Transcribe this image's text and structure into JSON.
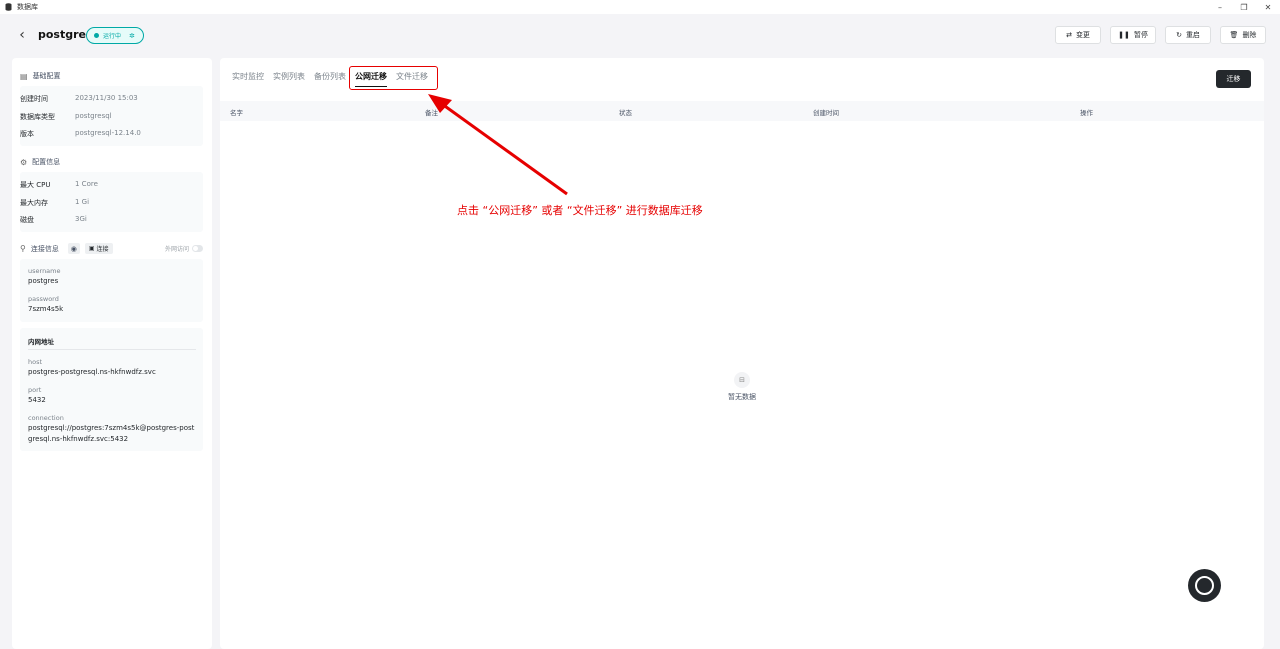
{
  "window": {
    "title": "数据库",
    "controls": [
      "–",
      "❐",
      "✕"
    ]
  },
  "header": {
    "back_icon": "chevron-left-icon",
    "db_name": "postgres",
    "status": "运行中",
    "status_color": "#00a9a6",
    "actions": [
      {
        "label": "变更",
        "icon": "⇄"
      },
      {
        "label": "暂停",
        "icon": "❚❚"
      },
      {
        "label": "重启",
        "icon": "↻"
      },
      {
        "label": "删除",
        "icon": "🗑"
      }
    ]
  },
  "basic": {
    "title": "基础配置",
    "rows": [
      {
        "k": "创建时间",
        "v": "2023/11/30 15:03"
      },
      {
        "k": "数据库类型",
        "v": "postgresql"
      },
      {
        "k": "版本",
        "v": "postgresql-12.14.0"
      }
    ]
  },
  "config": {
    "title": "配置信息",
    "rows": [
      {
        "k": "最大 CPU",
        "v": "1 Core"
      },
      {
        "k": "最大内存",
        "v": "1 Gi"
      },
      {
        "k": "磁盘",
        "v": "3Gi"
      }
    ]
  },
  "connection": {
    "title": "连接信息",
    "connect_label": "连接",
    "external_access": "外网访问",
    "username_label": "username",
    "username": "postgres",
    "password_label": "password",
    "password": "7szm4s5k",
    "internal_title": "内网地址",
    "host_label": "host",
    "host": "postgres-postgresql.ns-hkfnwdfz.svc",
    "port_label": "port",
    "port": "5432",
    "connection_label": "connection",
    "connection": "postgresql://postgres:7szm4s5k@postgres-postgresql.ns-hkfnwdfz.svc:5432"
  },
  "tabs": [
    "实时监控",
    "实例列表",
    "备份列表",
    "公网迁移",
    "文件迁移"
  ],
  "active_tab": "公网迁移",
  "migrate_button": "迁移",
  "table": {
    "columns": [
      "名字",
      "备注",
      "状态",
      "创建时间",
      "操作"
    ]
  },
  "empty_text": "暂无数据",
  "annotation": "点击 “公网迁移” 或者 “文件迁移” 进行数据库迁移",
  "accent_red": "#e60000"
}
